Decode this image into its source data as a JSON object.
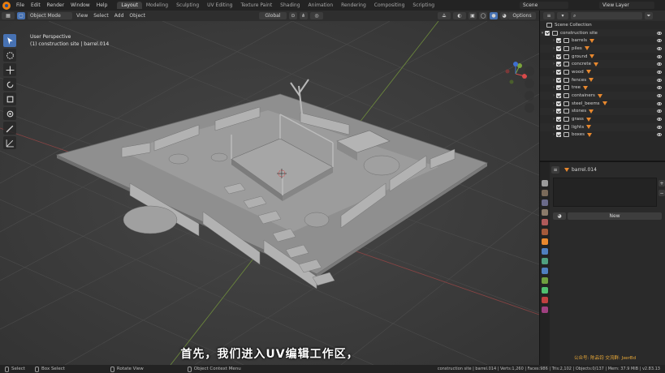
{
  "menu": [
    "File",
    "Edit",
    "Render",
    "Window",
    "Help"
  ],
  "workspaces": [
    {
      "label": "Layout",
      "active": true
    },
    {
      "label": "Modeling",
      "active": false
    },
    {
      "label": "Sculpting",
      "active": false
    },
    {
      "label": "UV Editing",
      "active": false
    },
    {
      "label": "Texture Paint",
      "active": false
    },
    {
      "label": "Shading",
      "active": false
    },
    {
      "label": "Animation",
      "active": false
    },
    {
      "label": "Rendering",
      "active": false
    },
    {
      "label": "Compositing",
      "active": false
    },
    {
      "label": "Scripting",
      "active": false
    }
  ],
  "scene": "Scene",
  "view_layer": "View Layer",
  "viewport_header": {
    "mode": "Object Mode",
    "menus": [
      "View",
      "Select",
      "Add",
      "Object"
    ],
    "orientation": "Global",
    "options": "Options"
  },
  "viewport": {
    "perspective": "User Perspective",
    "context": "(1) construction site | barrel.014"
  },
  "subtitle": "首先，我们进入UV编辑工作区，",
  "outliner": {
    "title": "Scene Collection",
    "root": "construction site",
    "items": [
      "barrels",
      "piles",
      "ground",
      "concrete",
      "wood",
      "fences",
      "tree",
      "containers",
      "steel_beems",
      "stones",
      "grass",
      "lights",
      "boxes"
    ]
  },
  "properties": {
    "object": "barrel.014",
    "new_label": "New"
  },
  "watermark": "公众号: 陈品钧 交流群: JxerBd",
  "status": {
    "select": "Select",
    "box_select": "Box Select",
    "rotate_view": "Rotate View",
    "context_menu": "Object Context Menu",
    "stats": "construction site | barrel.014 | Verts:1,260 | Faces:986 | Tris:2,102 | Objects:0/137 | Mem: 37.9 MiB | v2.83.13"
  },
  "colors": {
    "accent": "#4772b3",
    "logo": "#e87d0d",
    "object_icon": "#e8882e",
    "watermark": "#e8a838"
  }
}
